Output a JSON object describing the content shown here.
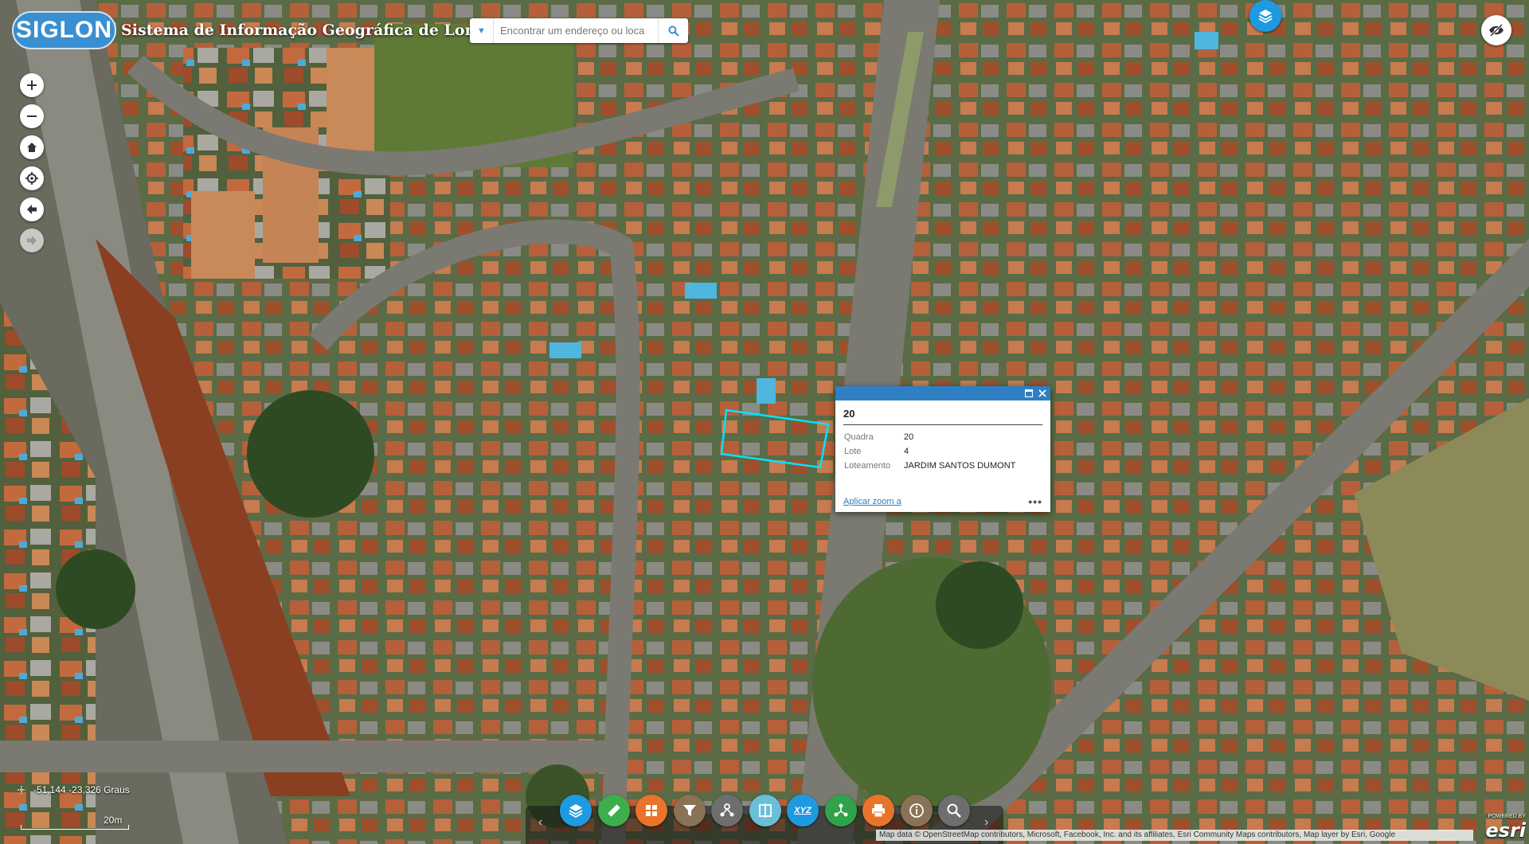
{
  "app": {
    "logo_text": "SIGLON",
    "title": "Sistema de Informação Geográfica de Londrina"
  },
  "search": {
    "placeholder": "Encontrar um endereço ou loca",
    "dropdown_icon": "caret-down-icon",
    "button_icon": "search-icon"
  },
  "nav": [
    {
      "name": "zoom-in-button",
      "icon": "plus-icon"
    },
    {
      "name": "zoom-out-button",
      "icon": "minus-icon"
    },
    {
      "name": "home-button",
      "icon": "home-icon"
    },
    {
      "name": "locate-button",
      "icon": "crosshair-icon"
    },
    {
      "name": "previous-extent-button",
      "icon": "arrow-left-icon"
    },
    {
      "name": "next-extent-button",
      "icon": "arrow-right-icon"
    }
  ],
  "popup": {
    "title": "20",
    "fields": [
      {
        "label": "Quadra",
        "value": "20"
      },
      {
        "label": "Lote",
        "value": "4"
      },
      {
        "label": "Loteamento",
        "value": "JARDIM SANTOS DUMONT"
      }
    ],
    "zoom_link": "Aplicar zoom a",
    "more": "•••"
  },
  "coords": {
    "text": "-51,144 -23,326 Graus"
  },
  "scale": {
    "label": "20m"
  },
  "toolbar": [
    {
      "name": "layers-tool",
      "icon": "layers-icon",
      "color": "#1e9be0"
    },
    {
      "name": "measure-tool",
      "icon": "ruler-icon",
      "color": "#3cae4a"
    },
    {
      "name": "basemap-tool",
      "icon": "grid-icon",
      "color": "#e8742a"
    },
    {
      "name": "filter-tool",
      "icon": "funnel-icon",
      "color": "#8a7256"
    },
    {
      "name": "network-tool",
      "icon": "network-icon",
      "color": "#6e6e6e"
    },
    {
      "name": "swipe-tool",
      "icon": "swipe-icon",
      "color": "#6abfd8"
    },
    {
      "name": "coordinates-tool",
      "icon": "xyz-icon",
      "color": "#1e9be0",
      "text": "XYZ"
    },
    {
      "name": "share-tool",
      "icon": "share-icon",
      "color": "#2fa24a"
    },
    {
      "name": "print-tool",
      "icon": "print-icon",
      "color": "#e8742a"
    },
    {
      "name": "about-tool",
      "icon": "info-icon",
      "color": "#8a7256"
    },
    {
      "name": "query-tool",
      "icon": "zoom-search-icon",
      "color": "#6e6e6e"
    }
  ],
  "attribution": "Map data © OpenStreetMap contributors, Microsoft, Facebook, Inc. and its affiliates, Esri Community Maps contributors, Map layer by Esri, Google",
  "esri": {
    "powered": "POWERED BY",
    "name": "esri"
  },
  "colors": {
    "accent": "#2f7fc2",
    "selection": "#00e5ff"
  }
}
